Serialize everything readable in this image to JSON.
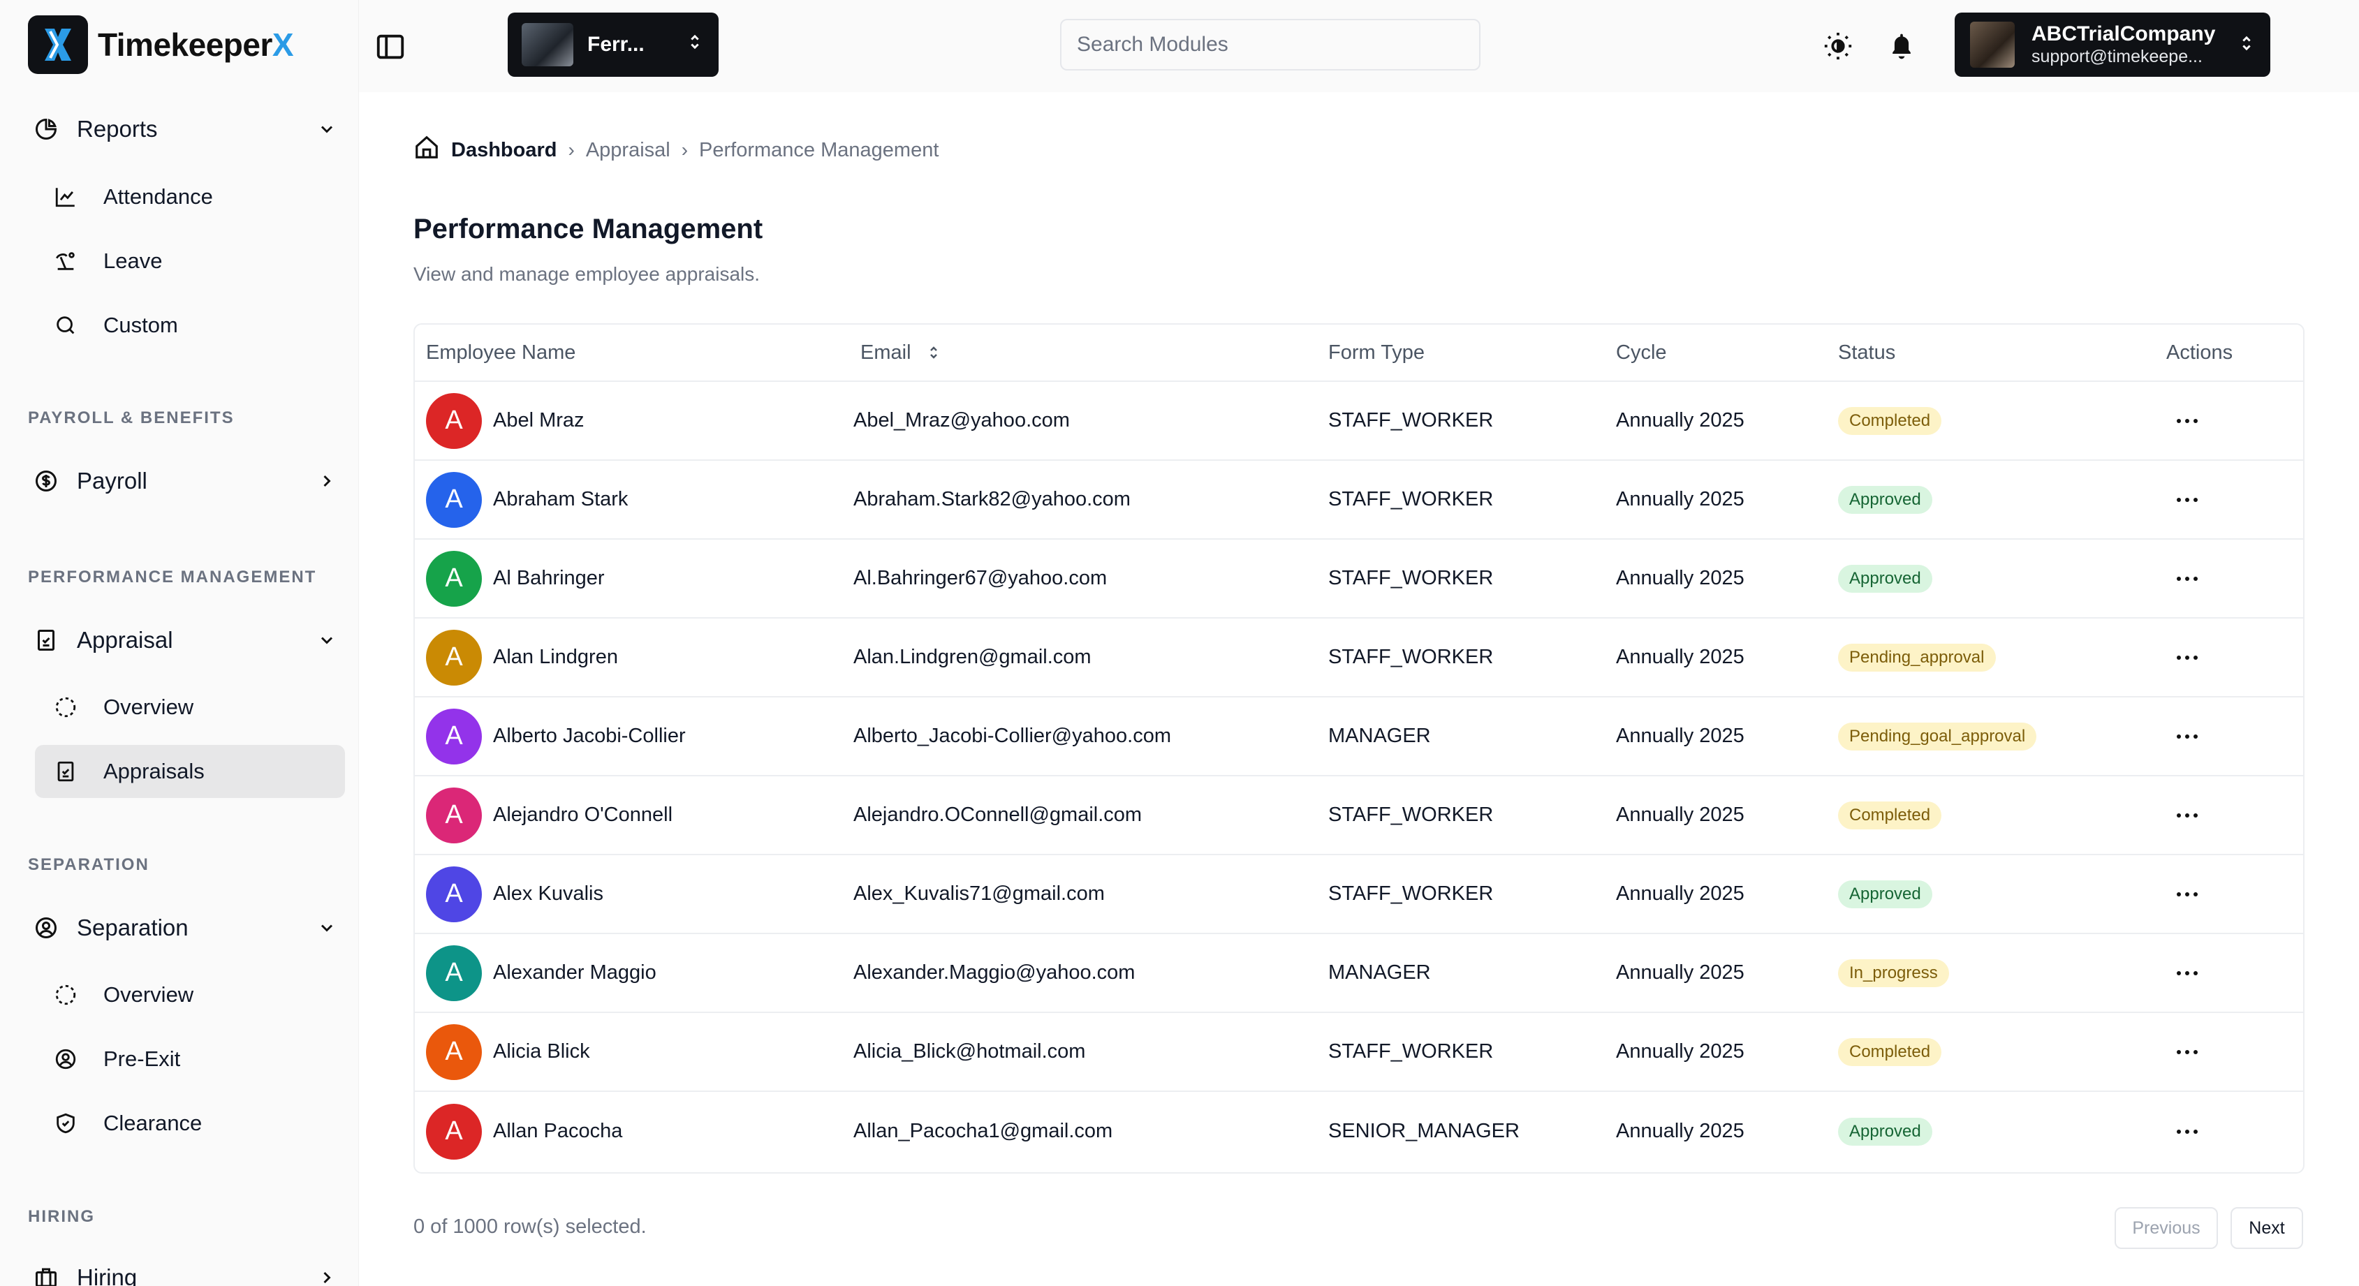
{
  "brand": {
    "name_main": "Timekeeper",
    "name_x": "X"
  },
  "sidebar": {
    "reports": {
      "label": "Reports",
      "items": [
        "Attendance",
        "Leave",
        "Custom"
      ]
    },
    "payroll_section": "PAYROLL & BENEFITS",
    "payroll": {
      "label": "Payroll"
    },
    "performance_section": "PERFORMANCE MANAGEMENT",
    "appraisal": {
      "label": "Appraisal",
      "items": [
        "Overview",
        "Appraisals"
      ],
      "active": "Appraisals"
    },
    "separation_section": "SEPARATION",
    "separation": {
      "label": "Separation",
      "items": [
        "Overview",
        "Pre-Exit",
        "Clearance"
      ]
    },
    "hiring_section": "HIRING",
    "hiring": {
      "label": "Hiring"
    }
  },
  "topbar": {
    "branch_name": "Ferr...",
    "search_placeholder": "Search Modules",
    "account_company": "ABCTrialCompany",
    "account_email": "support@timekeepe..."
  },
  "breadcrumb": {
    "home": "Dashboard",
    "parent": "Appraisal",
    "current": "Performance Management"
  },
  "page": {
    "title": "Performance Management",
    "subtitle": "View and manage employee appraisals."
  },
  "table": {
    "headers": {
      "name": "Employee Name",
      "email": "Email",
      "form": "Form Type",
      "cycle": "Cycle",
      "status": "Status",
      "actions": "Actions"
    },
    "rows": [
      {
        "initial": "A",
        "color": "#dc2626",
        "name": "Abel Mraz",
        "email": "Abel_Mraz@yahoo.com",
        "form": "STAFF_WORKER",
        "cycle": "Annually 2025",
        "status": "Completed",
        "status_kind": "completed"
      },
      {
        "initial": "A",
        "color": "#2563eb",
        "name": "Abraham Stark",
        "email": "Abraham.Stark82@yahoo.com",
        "form": "STAFF_WORKER",
        "cycle": "Annually 2025",
        "status": "Approved",
        "status_kind": "approved"
      },
      {
        "initial": "A",
        "color": "#16a34a",
        "name": "Al Bahringer",
        "email": "Al.Bahringer67@yahoo.com",
        "form": "STAFF_WORKER",
        "cycle": "Annually 2025",
        "status": "Approved",
        "status_kind": "approved"
      },
      {
        "initial": "A",
        "color": "#ca8a04",
        "name": "Alan Lindgren",
        "email": "Alan.Lindgren@gmail.com",
        "form": "STAFF_WORKER",
        "cycle": "Annually 2025",
        "status": "Pending_approval",
        "status_kind": "pending"
      },
      {
        "initial": "A",
        "color": "#9333ea",
        "name": "Alberto Jacobi-Collier",
        "email": "Alberto_Jacobi-Collier@yahoo.com",
        "form": "MANAGER",
        "cycle": "Annually 2025",
        "status": "Pending_goal_approval",
        "status_kind": "pending"
      },
      {
        "initial": "A",
        "color": "#db2777",
        "name": "Alejandro O'Connell",
        "email": "Alejandro.OConnell@gmail.com",
        "form": "STAFF_WORKER",
        "cycle": "Annually 2025",
        "status": "Completed",
        "status_kind": "completed"
      },
      {
        "initial": "A",
        "color": "#4f46e5",
        "name": "Alex Kuvalis",
        "email": "Alex_Kuvalis71@gmail.com",
        "form": "STAFF_WORKER",
        "cycle": "Annually 2025",
        "status": "Approved",
        "status_kind": "approved"
      },
      {
        "initial": "A",
        "color": "#0d9488",
        "name": "Alexander Maggio",
        "email": "Alexander.Maggio@yahoo.com",
        "form": "MANAGER",
        "cycle": "Annually 2025",
        "status": "In_progress",
        "status_kind": "progress"
      },
      {
        "initial": "A",
        "color": "#ea580c",
        "name": "Alicia Blick",
        "email": "Alicia_Blick@hotmail.com",
        "form": "STAFF_WORKER",
        "cycle": "Annually 2025",
        "status": "Completed",
        "status_kind": "completed"
      },
      {
        "initial": "A",
        "color": "#dc2626",
        "name": "Allan Pacocha",
        "email": "Allan_Pacocha1@gmail.com",
        "form": "SENIOR_MANAGER",
        "cycle": "Annually 2025",
        "status": "Approved",
        "status_kind": "approved"
      }
    ]
  },
  "footer": {
    "selection": "0 of 1000 row(s) selected.",
    "prev": "Previous",
    "next": "Next"
  }
}
